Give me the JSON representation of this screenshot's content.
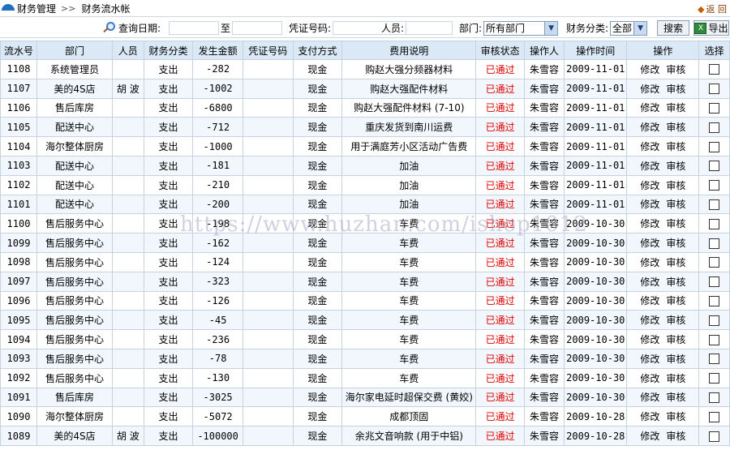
{
  "breadcrumb": {
    "section": "财务管理",
    "separator": ">>",
    "page": "财务流水帐"
  },
  "back_label": "返 回",
  "search": {
    "date_label": "查询日期:",
    "date_to": "至",
    "voucher_label": "凭证号码:",
    "person_label": "人员:",
    "dept_label": "部门:",
    "dept_value": "所有部门",
    "category_label": "财务分类:",
    "category_value": "全部",
    "search_button": "搜索",
    "export_button": "导出"
  },
  "table": {
    "headers": [
      "流水号",
      "部门",
      "人员",
      "财务分类",
      "发生金额",
      "凭证号码",
      "支付方式",
      "费用说明",
      "审核状态",
      "操作人",
      "操作时间",
      "操作",
      "选择"
    ],
    "op_modify": "修改",
    "op_review": "审核",
    "rows": [
      {
        "id": "1108",
        "dept": "系统管理员",
        "person": "",
        "cat": "支出",
        "amount": "-282",
        "voucher": "",
        "pay": "现金",
        "desc": "购赵大强分频器材料",
        "status": "已通过",
        "operator": "朱雪容",
        "time": "2009-11-01"
      },
      {
        "id": "1107",
        "dept": "美的4S店",
        "person": "胡 波",
        "cat": "支出",
        "amount": "-1002",
        "voucher": "",
        "pay": "现金",
        "desc": "购赵大强配件材料",
        "status": "已通过",
        "operator": "朱雪容",
        "time": "2009-11-01"
      },
      {
        "id": "1106",
        "dept": "售后库房",
        "person": "",
        "cat": "支出",
        "amount": "-6800",
        "voucher": "",
        "pay": "现金",
        "desc": "购赵大强配件材料 (7-10)",
        "status": "已通过",
        "operator": "朱雪容",
        "time": "2009-11-01"
      },
      {
        "id": "1105",
        "dept": "配送中心",
        "person": "",
        "cat": "支出",
        "amount": "-712",
        "voucher": "",
        "pay": "现金",
        "desc": "重庆发货到南川运费",
        "status": "已通过",
        "operator": "朱雪容",
        "time": "2009-11-01"
      },
      {
        "id": "1104",
        "dept": "海尔整体厨房",
        "person": "",
        "cat": "支出",
        "amount": "-1000",
        "voucher": "",
        "pay": "现金",
        "desc": "用于满庭芳小区活动广告费",
        "status": "已通过",
        "operator": "朱雪容",
        "time": "2009-11-01"
      },
      {
        "id": "1103",
        "dept": "配送中心",
        "person": "",
        "cat": "支出",
        "amount": "-181",
        "voucher": "",
        "pay": "现金",
        "desc": "加油",
        "status": "已通过",
        "operator": "朱雪容",
        "time": "2009-11-01"
      },
      {
        "id": "1102",
        "dept": "配送中心",
        "person": "",
        "cat": "支出",
        "amount": "-210",
        "voucher": "",
        "pay": "现金",
        "desc": "加油",
        "status": "已通过",
        "operator": "朱雪容",
        "time": "2009-11-01"
      },
      {
        "id": "1101",
        "dept": "配送中心",
        "person": "",
        "cat": "支出",
        "amount": "-200",
        "voucher": "",
        "pay": "现金",
        "desc": "加油",
        "status": "已通过",
        "operator": "朱雪容",
        "time": "2009-11-01"
      },
      {
        "id": "1100",
        "dept": "售后服务中心",
        "person": "",
        "cat": "支出",
        "amount": "-198",
        "voucher": "",
        "pay": "现金",
        "desc": "车费",
        "status": "已通过",
        "operator": "朱雪容",
        "time": "2009-10-30"
      },
      {
        "id": "1099",
        "dept": "售后服务中心",
        "person": "",
        "cat": "支出",
        "amount": "-162",
        "voucher": "",
        "pay": "现金",
        "desc": "车费",
        "status": "已通过",
        "operator": "朱雪容",
        "time": "2009-10-30"
      },
      {
        "id": "1098",
        "dept": "售后服务中心",
        "person": "",
        "cat": "支出",
        "amount": "-124",
        "voucher": "",
        "pay": "现金",
        "desc": "车费",
        "status": "已通过",
        "operator": "朱雪容",
        "time": "2009-10-30"
      },
      {
        "id": "1097",
        "dept": "售后服务中心",
        "person": "",
        "cat": "支出",
        "amount": "-323",
        "voucher": "",
        "pay": "现金",
        "desc": "车费",
        "status": "已通过",
        "operator": "朱雪容",
        "time": "2009-10-30"
      },
      {
        "id": "1096",
        "dept": "售后服务中心",
        "person": "",
        "cat": "支出",
        "amount": "-126",
        "voucher": "",
        "pay": "现金",
        "desc": "车费",
        "status": "已通过",
        "operator": "朱雪容",
        "time": "2009-10-30"
      },
      {
        "id": "1095",
        "dept": "售后服务中心",
        "person": "",
        "cat": "支出",
        "amount": "-45",
        "voucher": "",
        "pay": "现金",
        "desc": "车费",
        "status": "已通过",
        "operator": "朱雪容",
        "time": "2009-10-30"
      },
      {
        "id": "1094",
        "dept": "售后服务中心",
        "person": "",
        "cat": "支出",
        "amount": "-236",
        "voucher": "",
        "pay": "现金",
        "desc": "车费",
        "status": "已通过",
        "operator": "朱雪容",
        "time": "2009-10-30"
      },
      {
        "id": "1093",
        "dept": "售后服务中心",
        "person": "",
        "cat": "支出",
        "amount": "-78",
        "voucher": "",
        "pay": "现金",
        "desc": "车费",
        "status": "已通过",
        "operator": "朱雪容",
        "time": "2009-10-30"
      },
      {
        "id": "1092",
        "dept": "售后服务中心",
        "person": "",
        "cat": "支出",
        "amount": "-130",
        "voucher": "",
        "pay": "现金",
        "desc": "车费",
        "status": "已通过",
        "operator": "朱雪容",
        "time": "2009-10-30"
      },
      {
        "id": "1091",
        "dept": "售后库房",
        "person": "",
        "cat": "支出",
        "amount": "-3025",
        "voucher": "",
        "pay": "现金",
        "desc": "海尔家电延时超保交费 (黄姣)",
        "status": "已通过",
        "operator": "朱雪容",
        "time": "2009-10-30"
      },
      {
        "id": "1090",
        "dept": "海尔整体厨房",
        "person": "",
        "cat": "支出",
        "amount": "-5072",
        "voucher": "",
        "pay": "现金",
        "desc": "成都顶固",
        "status": "已通过",
        "operator": "朱雪容",
        "time": "2009-10-28"
      },
      {
        "id": "1089",
        "dept": "美的4S店",
        "person": "胡 波",
        "cat": "支出",
        "amount": "-100000",
        "voucher": "",
        "pay": "现金",
        "desc": "余兆文音响款 (用于中铝)",
        "status": "已通过",
        "operator": "朱雪容",
        "time": "2009-10-28"
      }
    ]
  },
  "watermark": "https://www.huzhan.com/ishop1012",
  "colors": {
    "status_approved": "#e00000",
    "header_bg": "#dbe9f7",
    "accent_blue": "#1e6fc0"
  }
}
